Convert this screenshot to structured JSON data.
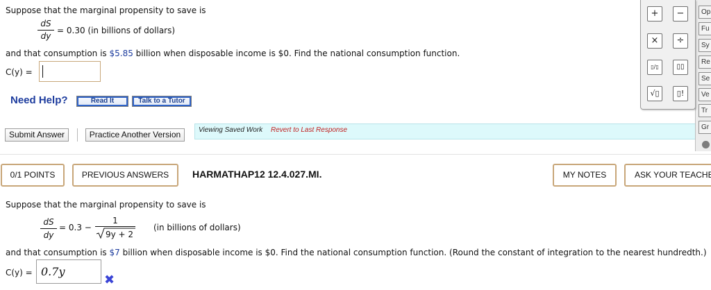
{
  "question1": {
    "intro": "Suppose that the marginal propensity to save is",
    "frac_num": "dS",
    "frac_den": "dy",
    "eq_rest": "= 0.30 (in billions of dollars)",
    "line2_pre": "and that consumption is ",
    "line2_amount": "$5.85",
    "line2_post": " billion when disposable income is $0. Find the national consumption function.",
    "answer_label": "C(y) =",
    "answer_value": ""
  },
  "help": {
    "label": "Need Help?",
    "read_it": "Read It",
    "talk_tutor": "Talk to a Tutor"
  },
  "actions": {
    "submit": "Submit Answer",
    "practice": "Practice Another Version"
  },
  "banner": {
    "viewing": "Viewing Saved Work",
    "revert": "Revert to Last Response"
  },
  "palette": {
    "keys": [
      "+",
      "−",
      "×",
      "÷",
      "▯/▯",
      "▯▯",
      "√▯",
      "▯!"
    ]
  },
  "side_tabs": [
    "Op",
    "Fu",
    "Sy",
    "Re",
    "Se",
    "Ve",
    "Tr",
    "Gr"
  ],
  "question2": {
    "points": "0/1 POINTS",
    "previous": "PREVIOUS ANSWERS",
    "qid": "HARMATHAP12 12.4.027.MI.",
    "my_notes": "MY NOTES",
    "ask_teacher": "ASK YOUR TEACHER",
    "intro": "Suppose that the marginal propensity to save is",
    "frac_num": "dS",
    "frac_den": "dy",
    "eq_const": "= 0.3 −",
    "sqrt_num": "1",
    "sqrt_den": "9y + 2",
    "eq_unit": "(in billions of dollars)",
    "line2_pre": "and that consumption is ",
    "line2_amount": "$7",
    "line2_post": " billion when disposable income is $0. Find the national consumption function. (Round the constant of integration to the nearest hundredth.)",
    "answer_label": "C(y) =",
    "answer_value": "0.7y"
  }
}
